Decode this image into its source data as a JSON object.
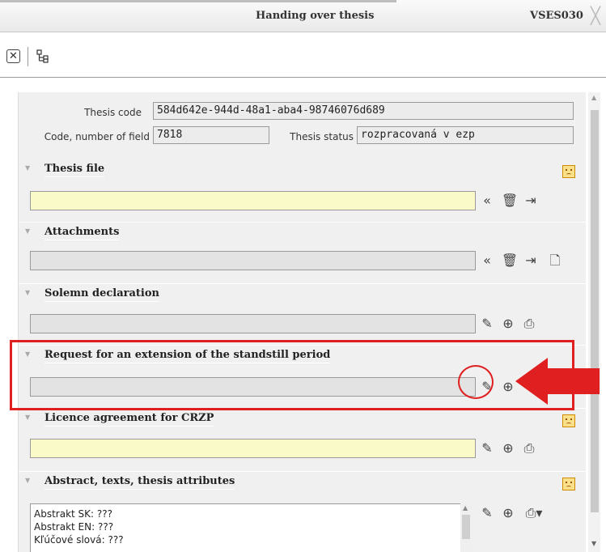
{
  "window": {
    "title": "Handing over thesis",
    "code": "VSES030",
    "close_glyph": "╳"
  },
  "toolbar": {
    "close_glyph": "✕",
    "icons": [
      "close-icon",
      "org-structure-icon"
    ]
  },
  "form": {
    "thesis_code_label": "Thesis code",
    "thesis_code_value": "584d642e-944d-48a1-aba4-98746076d689",
    "code_field_label": "Code, number of field",
    "code_field_value": "7818",
    "status_label": "Thesis status",
    "status_value": "rozpracovaná v ezp"
  },
  "sections": [
    {
      "name": "Thesis file",
      "warning": true,
      "input_color": "yellow",
      "icons": [
        "import-icon",
        "delete-icon",
        "upload-icon"
      ]
    },
    {
      "name": "Attachments",
      "warning": false,
      "input_color": "grey",
      "icons": [
        "import-icon",
        "delete-icon",
        "upload-icon",
        "new-file-icon"
      ]
    },
    {
      "name": "Solemn declaration",
      "warning": false,
      "input_color": "grey",
      "icons": [
        "edit-icon",
        "zoom-icon",
        "print-icon"
      ]
    },
    {
      "name": "Request for an extension of the standstill period",
      "warning": false,
      "input_color": "grey",
      "icons": [
        "edit-icon",
        "zoom-icon"
      ]
    },
    {
      "name": "Licence agreement for CRZP",
      "warning": true,
      "input_color": "yellow",
      "icons": [
        "edit-icon",
        "zoom-icon",
        "print-icon"
      ]
    },
    {
      "name": "Abstract, texts, thesis attributes",
      "warning": true,
      "input_color": "white",
      "icons": [
        "edit-icon",
        "zoom-icon",
        "print-dropdown-icon"
      ]
    }
  ],
  "abstract_lines": [
    "Abstrakt SK: ???",
    "Abstrakt EN: ???",
    "Kľúčové slová: ???"
  ],
  "colors": {
    "highlight": "#e02020",
    "yellow_field": "#fafac8",
    "warning_badge": "#fbe08a"
  }
}
